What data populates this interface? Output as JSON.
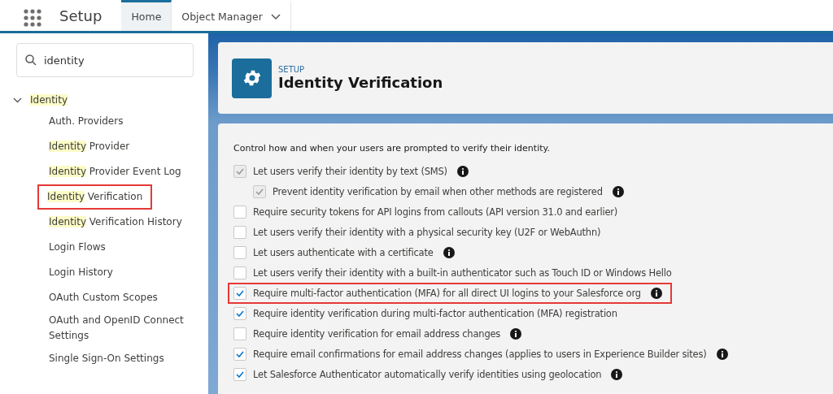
{
  "app": {
    "title": "Setup"
  },
  "tabs": [
    {
      "label": "Home",
      "selected": true,
      "dropdown": false
    },
    {
      "label": "Object Manager",
      "selected": false,
      "dropdown": true
    }
  ],
  "search": {
    "value": "identity"
  },
  "tree": {
    "match": "Identity",
    "expanded": true,
    "children": [
      {
        "rest": "Auth. Providers",
        "outlined": false
      },
      {
        "match": "Identity",
        "rest": " Provider",
        "outlined": false
      },
      {
        "match": "Identity",
        "rest": " Provider Event Log",
        "outlined": false
      },
      {
        "match": "Identity",
        "rest": " Verification",
        "outlined": true
      },
      {
        "match": "Identity",
        "rest": " Verification History",
        "outlined": false
      },
      {
        "rest": "Login Flows",
        "outlined": false
      },
      {
        "rest": "Login History",
        "outlined": false
      },
      {
        "rest": "OAuth Custom Scopes",
        "outlined": false
      },
      {
        "rest": "OAuth and OpenID Connect Settings",
        "outlined": false
      },
      {
        "rest": "Single Sign-On Settings",
        "outlined": false
      }
    ]
  },
  "header": {
    "eyebrow": "SETUP",
    "title": "Identity Verification"
  },
  "intro": "Control how and when your users are prompted to verify their identity.",
  "options": [
    {
      "label": "Let users verify their identity by text (SMS)",
      "checked": true,
      "disabled": true,
      "info": true,
      "outlined": false,
      "children": [
        {
          "label": "Prevent identity verification by email when other methods are registered",
          "checked": true,
          "disabled": true,
          "info": true,
          "outlined": false
        }
      ]
    },
    {
      "label": "Require security tokens for API logins from callouts (API version 31.0 and earlier)",
      "checked": false,
      "disabled": false,
      "info": false,
      "outlined": false
    },
    {
      "label": "Let users verify their identity with a physical security key (U2F or WebAuthn)",
      "checked": false,
      "disabled": false,
      "info": false,
      "outlined": false
    },
    {
      "label": "Let users authenticate with a certificate",
      "checked": false,
      "disabled": false,
      "info": true,
      "outlined": false
    },
    {
      "label": "Let users verify their identity with a built-in authenticator such as Touch ID or Windows Hello",
      "checked": false,
      "disabled": false,
      "info": false,
      "outlined": false
    },
    {
      "label": "Require multi-factor authentication (MFA) for all direct UI logins to your Salesforce org",
      "checked": true,
      "disabled": false,
      "info": true,
      "outlined": true
    },
    {
      "label": "Require identity verification during multi-factor authentication (MFA) registration",
      "checked": true,
      "disabled": false,
      "info": false,
      "outlined": false
    },
    {
      "label": "Require identity verification for email address changes",
      "checked": false,
      "disabled": false,
      "info": true,
      "outlined": false
    },
    {
      "label": "Require email confirmations for email address changes (applies to users in Experience Builder sites)",
      "checked": true,
      "disabled": false,
      "info": true,
      "outlined": false
    },
    {
      "label": "Let Salesforce Authenticator automatically verify identities using geolocation",
      "checked": true,
      "disabled": false,
      "info": true,
      "outlined": false
    }
  ]
}
